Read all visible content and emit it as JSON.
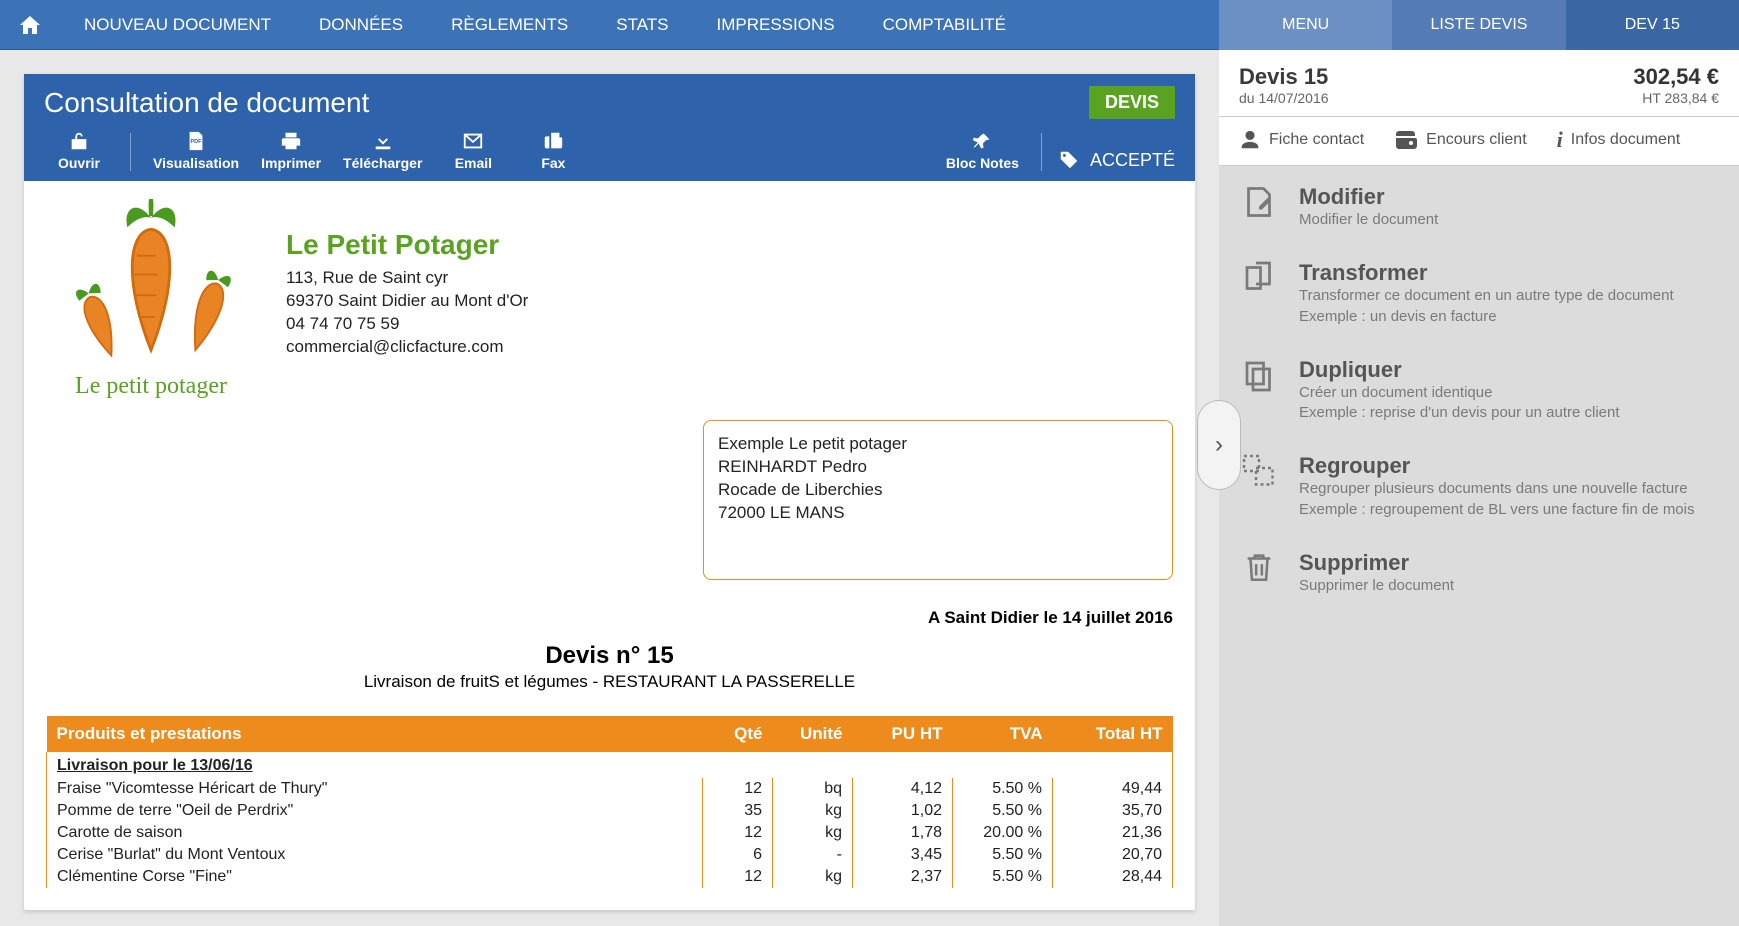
{
  "nav": {
    "items": [
      "NOUVEAU DOCUMENT",
      "DONNÉES",
      "RÈGLEMENTS",
      "STATS",
      "IMPRESSIONS",
      "COMPTABILITÉ"
    ]
  },
  "rightTabs": {
    "t1": "MENU",
    "t2": "LISTE DEVIS",
    "t3": "DEV 15"
  },
  "rightHeader": {
    "title": "Devis 15",
    "date": "du 14/07/2016",
    "total": "302,54 €",
    "ht": "HT  283,84 €"
  },
  "rightInfo": {
    "fiche": "Fiche contact",
    "encours": "Encours client",
    "infos": "Infos document"
  },
  "actions": [
    {
      "title": "Modifier",
      "desc": "Modifier le document"
    },
    {
      "title": "Transformer",
      "desc": "Transformer ce document en un autre type de document\nExemple : un devis en facture"
    },
    {
      "title": "Dupliquer",
      "desc": "Créer un document identique\nExemple : reprise d'un devis pour un autre client"
    },
    {
      "title": "Regrouper",
      "desc": "Regrouper plusieurs documents dans une nouvelle facture\nExemple : regroupement de BL vers une facture fin de mois"
    },
    {
      "title": "Supprimer",
      "desc": "Supprimer le document"
    }
  ],
  "doc": {
    "consultTitle": "Consultation de document",
    "badgeDevis": "DEVIS",
    "toolbar": {
      "ouvrir": "Ouvrir",
      "visualisation": "Visualisation",
      "imprimer": "Imprimer",
      "telecharger": "Télécharger",
      "email": "Email",
      "fax": "Fax",
      "blocnotes": "Bloc Notes",
      "accepte": "ACCEPTÉ"
    },
    "company": {
      "name": "Le Petit Potager",
      "addr1": "113, Rue de Saint cyr",
      "addr2": "69370 Saint Didier au Mont d'Or",
      "phone": "04 74 70 75 59",
      "email": "commercial@clicfacture.com",
      "brandMini": "Le petit potager"
    },
    "client": {
      "l1": "Exemple Le petit potager",
      "l2": "REINHARDT Pedro",
      "l3": "Rocade de Liberchies",
      "l4": "72000 LE MANS"
    },
    "cityDate": "A Saint Didier le 14 juillet 2016",
    "docTitle": "Devis n° 15",
    "docSubtitle": "Livraison de fruitS et légumes - RESTAURANT LA PASSERELLE",
    "table": {
      "headers": [
        "Produits et prestations",
        "Qté",
        "Unité",
        "PU HT",
        "TVA",
        "Total HT"
      ],
      "section": "Livraison pour le 13/06/16",
      "rows": [
        {
          "p": "Fraise \"Vicomtesse Héricart de Thury\"",
          "q": "12",
          "u": "bq",
          "pu": "4,12",
          "tva": "5.50 %",
          "t": "49,44"
        },
        {
          "p": "Pomme de terre \"Oeil de Perdrix\"",
          "q": "35",
          "u": "kg",
          "pu": "1,02",
          "tva": "5.50 %",
          "t": "35,70"
        },
        {
          "p": "Carotte de saison",
          "q": "12",
          "u": "kg",
          "pu": "1,78",
          "tva": "20.00 %",
          "t": "21,36"
        },
        {
          "p": "Cerise \"Burlat\" du Mont Ventoux",
          "q": "6",
          "u": "-",
          "pu": "3,45",
          "tva": "5.50 %",
          "t": "20,70"
        },
        {
          "p": "Clémentine Corse \"Fine\"",
          "q": "12",
          "u": "kg",
          "pu": "2,37",
          "tva": "5.50 %",
          "t": "28,44"
        }
      ]
    }
  }
}
